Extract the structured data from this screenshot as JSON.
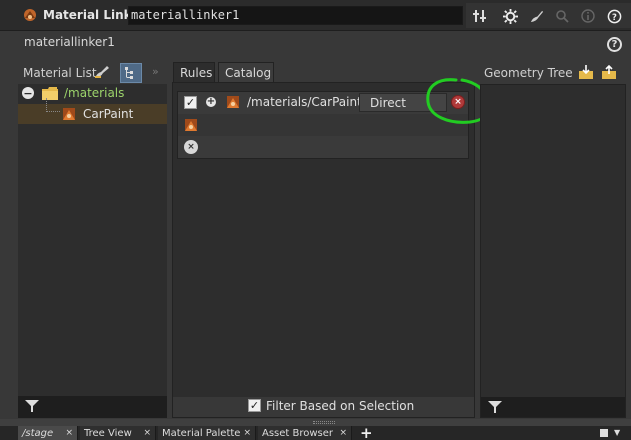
{
  "toolbar": {
    "node_type": "Material Linker",
    "node_name": "materiallinker1"
  },
  "header": {
    "node_label": "materiallinker1",
    "help_glyph": "?"
  },
  "material_list": {
    "label": "Material List",
    "more_glyph": "»",
    "tree": [
      {
        "label": "/materials",
        "expand_glyph": "−"
      },
      {
        "label": "CarPaint"
      }
    ]
  },
  "tabs": {
    "rules": "Rules",
    "catalog": "Catalog"
  },
  "rule": {
    "checked_glyph": "✓",
    "add_glyph": "+",
    "path": "/materials/CarPaint",
    "mode": "Direct",
    "delete_glyph": "×",
    "clear_glyph": "×"
  },
  "filter": {
    "checked_glyph": "✓",
    "label": "Filter Based on Selection"
  },
  "geometry_tree": {
    "label": "Geometry Tree"
  },
  "bottom_tabs": [
    {
      "label": "/stage"
    },
    {
      "label": "Tree View"
    },
    {
      "label": "Material Palette"
    },
    {
      "label": "Asset Browser"
    }
  ],
  "bottom_tab_close_glyph": "×",
  "bottom_add_glyph": "+",
  "bottom_arrow_glyph": "▼",
  "colors": {
    "annotation_circle": "#22cc22",
    "selected_row": "#4a3d27",
    "folder_label": "#9cd36b",
    "delete_button": "#b03a3a"
  },
  "icons": [
    "node-type-icon",
    "pin-icon",
    "gear-icon",
    "brush-icon",
    "search-icon",
    "info-icon",
    "help-icon",
    "folder-icon",
    "material-icon",
    "funnel-icon",
    "download-icon",
    "upload-icon"
  ]
}
